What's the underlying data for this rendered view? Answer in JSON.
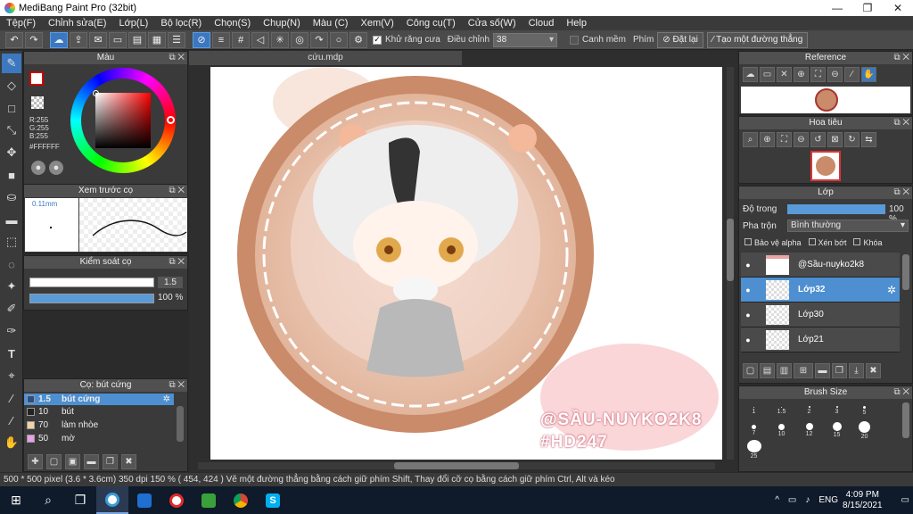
{
  "window": {
    "title": "MediBang Paint Pro (32bit)"
  },
  "menu": [
    "Tệp(F)",
    "Chỉnh sửa(E)",
    "Lớp(L)",
    "Bộ lọc(R)",
    "Chọn(S)",
    "Chụp(N)",
    "Màu (C)",
    "Xem(V)",
    "Công cụ(T)",
    "Cửa số(W)",
    "Cloud",
    "Help"
  ],
  "toolbar": {
    "antialias_label": "Khử răng cưa",
    "adjust_label": "Điều chỉnh",
    "adjust_value": "38",
    "ruler_label": "Canh mềm",
    "snap_label": "Phím",
    "snap_off": "Đặt lại",
    "straight_line": "Tạo một đường thẳng"
  },
  "color_panel": {
    "title": "Màu",
    "r": "R:255",
    "g": "G:255",
    "b": "B:255",
    "hex": "#FFFFFF",
    "primary": "#cc0000",
    "secondary": "#ffffff"
  },
  "brush_preview": {
    "title": "Xem trước cọ",
    "size": "0.11mm"
  },
  "brush_control": {
    "title": "Kiểm soát cọ",
    "size": "1.5",
    "opacity": "100 %"
  },
  "brush_list": {
    "title": "Cọ: bút cứng",
    "items": [
      {
        "size": "1.5",
        "name": "bút cứng",
        "color": "#2a4f80"
      },
      {
        "size": "10",
        "name": "bút",
        "color": "#222222"
      },
      {
        "size": "70",
        "name": "làm nhòe",
        "color": "#f3d2a6"
      },
      {
        "size": "50",
        "name": "mờ",
        "color": "#e8a0e8"
      }
    ]
  },
  "document": {
    "tab": "cứu.mdp",
    "watermark_line1": "@SẦU-NUYKO2K8",
    "watermark_line2": "#HD247"
  },
  "status": "500 * 500 pixel   (3.6 * 3.6cm)   350 dpi   150 %   ( 454, 424 )   Vẽ một đường thẳng bằng cách giữ phím Shift, Thay đổi cỡ cọ bằng cách giữ phím Ctrl, Alt và kéo",
  "reference": {
    "title": "Reference"
  },
  "navigator": {
    "title": "Hoa tiêu"
  },
  "layers": {
    "title": "Lớp",
    "opacity_label": "Độ trong",
    "opacity_value": "100 %",
    "blend_label": "Pha trộn",
    "blend_value": "Bình thường",
    "protect_alpha": "Bảo vệ alpha",
    "clipping": "Xén bớt",
    "lock": "Khóa",
    "items": [
      {
        "name": "@Sầu-nuyko2k8",
        "selected": false
      },
      {
        "name": "Lớp32",
        "selected": true
      },
      {
        "name": "Lớp30",
        "selected": false
      },
      {
        "name": "Lớp21",
        "selected": false
      }
    ]
  },
  "brush_size": {
    "title": "Brush Size",
    "sizes": [
      "1",
      "1.5",
      "2",
      "3",
      "5",
      "7",
      "10",
      "12",
      "15",
      "20",
      "25"
    ]
  },
  "taskbar": {
    "lang": "ENG",
    "time": "4:09 PM",
    "date": "8/15/2021"
  }
}
